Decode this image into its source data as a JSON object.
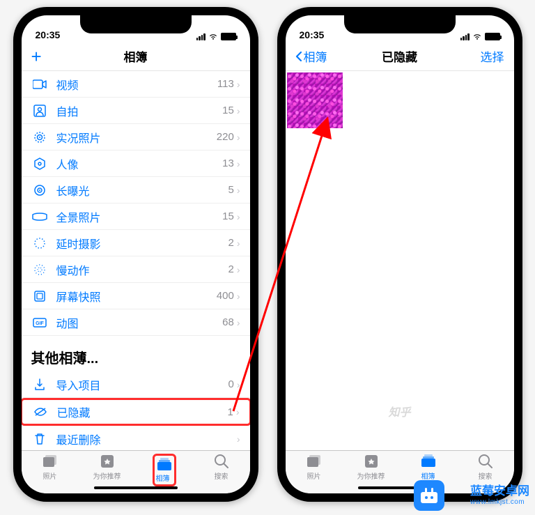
{
  "status": {
    "time": "20:35"
  },
  "phone1": {
    "nav": {
      "title": "相簿"
    },
    "media_types": [
      {
        "icon": "video",
        "label": "视频",
        "count": "113"
      },
      {
        "icon": "selfie",
        "label": "自拍",
        "count": "15"
      },
      {
        "icon": "live",
        "label": "实况照片",
        "count": "220"
      },
      {
        "icon": "portrait",
        "label": "人像",
        "count": "13"
      },
      {
        "icon": "longexp",
        "label": "长曝光",
        "count": "5"
      },
      {
        "icon": "pano",
        "label": "全景照片",
        "count": "15"
      },
      {
        "icon": "timelapse",
        "label": "延时摄影",
        "count": "2"
      },
      {
        "icon": "slomo",
        "label": "慢动作",
        "count": "2"
      },
      {
        "icon": "screenshot",
        "label": "屏幕快照",
        "count": "400"
      },
      {
        "icon": "gif",
        "label": "动图",
        "count": "68"
      }
    ],
    "other_section": "其他相薄...",
    "other_albums": [
      {
        "icon": "import",
        "label": "导入项目",
        "count": "0",
        "hl": false
      },
      {
        "icon": "hidden",
        "label": "已隐藏",
        "count": "1",
        "hl": true
      },
      {
        "icon": "trash",
        "label": "最近删除",
        "count": "",
        "hl": false
      }
    ],
    "tabs": [
      {
        "label": "照片",
        "active": false
      },
      {
        "label": "为你推荐",
        "active": false
      },
      {
        "label": "相簿",
        "active": true,
        "hl": true
      },
      {
        "label": "搜索",
        "active": false
      }
    ]
  },
  "phone2": {
    "nav": {
      "back": "相簿",
      "title": "已隐藏",
      "right": "选择"
    },
    "tabs": [
      {
        "label": "照片",
        "active": false
      },
      {
        "label": "为你推荐",
        "active": false
      },
      {
        "label": "相簿",
        "active": true
      },
      {
        "label": "搜索",
        "active": false
      }
    ],
    "zhihu": "知乎"
  },
  "watermark": {
    "name": "蓝莓安卓网",
    "url": "www.lmkjst.com"
  }
}
